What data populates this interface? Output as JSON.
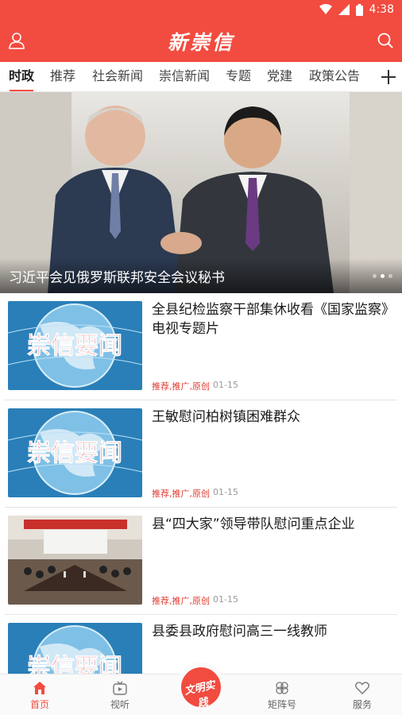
{
  "status_bar": {
    "time": "4:38"
  },
  "header": {
    "title": "新崇信"
  },
  "tabs": [
    {
      "label": "时政",
      "active": true
    },
    {
      "label": "推荐"
    },
    {
      "label": "社会新闻"
    },
    {
      "label": "崇信新闻"
    },
    {
      "label": "专题"
    },
    {
      "label": "党建"
    },
    {
      "label": "政策公告"
    }
  ],
  "banner": {
    "caption": "习近平会见俄罗斯联邦安全会议秘书",
    "slides": 3,
    "current_slide": 2
  },
  "news": [
    {
      "title": "全县纪检监察干部集休收看《国家监察》电视专题片",
      "tags": "推荐,推广,原创",
      "date": "01-15",
      "thumb_text": "崇信要闻",
      "thumb": "globe"
    },
    {
      "title": "王敏慰问柏树镇困难群众",
      "tags": "推荐,推广,原创",
      "date": "01-15",
      "thumb_text": "崇信要闻",
      "thumb": "globe"
    },
    {
      "title": "县“四大家”领导带队慰问重点企业",
      "tags": "推荐,推广,原创",
      "date": "01-15",
      "thumb": "meeting"
    },
    {
      "title": "县委县政府慰问高三一线教师",
      "tags": "",
      "date": "",
      "thumb_text": "崇信要闻",
      "thumb": "globe"
    }
  ],
  "bottom_nav": [
    {
      "label": "首页",
      "icon": "home-icon",
      "active": true
    },
    {
      "label": "视听",
      "icon": "tv-icon"
    },
    {
      "label": "矩阵号",
      "icon": "clover-icon"
    },
    {
      "label": "服务",
      "icon": "heart-icon"
    }
  ],
  "center_button": {
    "text": "文明实践"
  },
  "colors": {
    "brand": "#f24b3f",
    "tag": "#e23b30"
  }
}
